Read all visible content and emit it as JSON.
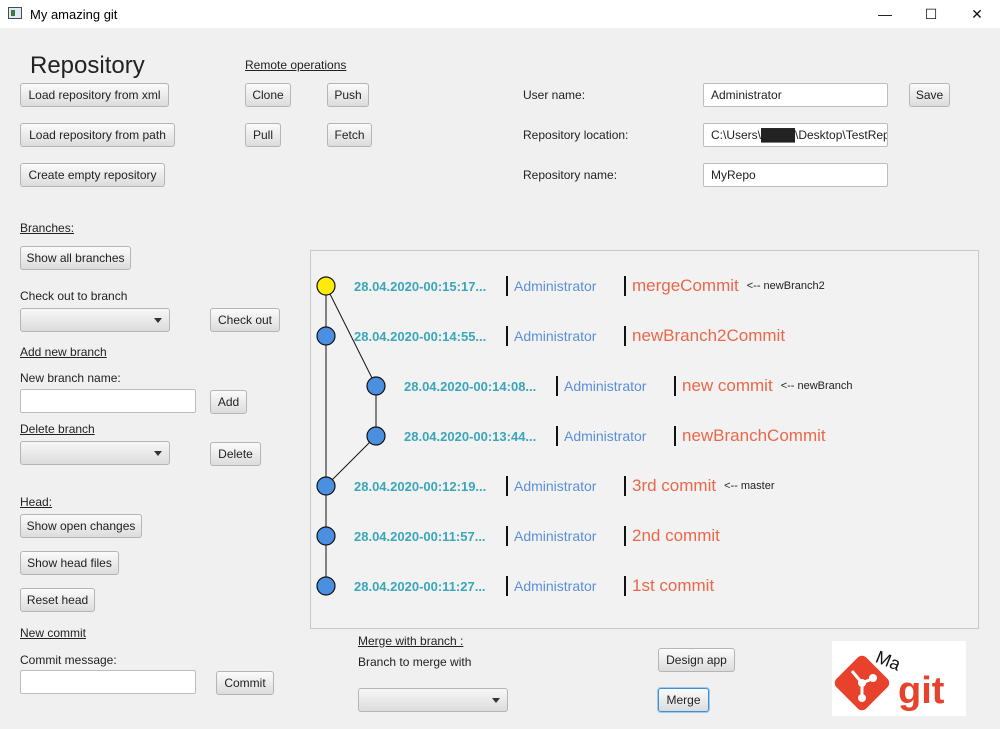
{
  "window": {
    "title": "My amazing git",
    "minimize": "—",
    "maximize": "☐",
    "close": "✕"
  },
  "heading": "Repository",
  "repo_buttons": {
    "load_xml": "Load repository from xml",
    "load_path": "Load repository from path",
    "create_empty": "Create empty repository"
  },
  "remote": {
    "title": "Remote operations",
    "clone": "Clone",
    "push": "Push",
    "pull": "Pull",
    "fetch": "Fetch"
  },
  "settings": {
    "user_name_label": "User name:",
    "user_name_value": "Administrator",
    "save": "Save",
    "location_label": "Repository location:",
    "location_value": "C:\\Users\\████\\Desktop\\TestRep",
    "name_label": "Repository name:",
    "name_value": "MyRepo"
  },
  "branches": {
    "title": "Branches:",
    "show_all": "Show all branches",
    "checkout_label": "Check out to branch",
    "checkout_button": "Check out",
    "add_title": "Add new branch",
    "new_name_label": "New branch name:",
    "add_button": "Add",
    "delete_title": "Delete branch",
    "delete_button": "Delete"
  },
  "head": {
    "title": "Head:",
    "show_open_changes": "Show open changes",
    "show_head_files": "Show head files",
    "reset_head": "Reset head"
  },
  "commit": {
    "title": "New commit",
    "message_label": "Commit message:",
    "commit_button": "Commit"
  },
  "merge": {
    "title": "Merge with branch :",
    "branch_label": "Branch to merge with",
    "design_app": "Design app",
    "merge_button": "Merge"
  },
  "commits": [
    {
      "date": "28.04.2020-00:15:17...",
      "author": "Administrator",
      "message": "mergeCommit",
      "branch": "<-- newBranch2",
      "lane": 0,
      "color": "#ffeb0a"
    },
    {
      "date": "28.04.2020-00:14:55...",
      "author": "Administrator",
      "message": "newBranch2Commit",
      "branch": "",
      "lane": 0,
      "color": "#4a8fe0"
    },
    {
      "date": "28.04.2020-00:14:08...",
      "author": "Administrator",
      "message": "new commit",
      "branch": "<-- newBranch",
      "lane": 1,
      "color": "#4a8fe0"
    },
    {
      "date": "28.04.2020-00:13:44...",
      "author": "Administrator",
      "message": "newBranchCommit",
      "branch": "",
      "lane": 1,
      "color": "#4a8fe0"
    },
    {
      "date": "28.04.2020-00:12:19...",
      "author": "Administrator",
      "message": "3rd commit",
      "branch": "<-- master",
      "lane": 0,
      "color": "#4a8fe0"
    },
    {
      "date": "28.04.2020-00:11:57...",
      "author": "Administrator",
      "message": "2nd commit",
      "branch": "",
      "lane": 0,
      "color": "#4a8fe0"
    },
    {
      "date": "28.04.2020-00:11:27...",
      "author": "Administrator",
      "message": "1st commit",
      "branch": "",
      "lane": 0,
      "color": "#4a8fe0"
    }
  ],
  "logo": {
    "small": "Ma",
    "big": "git",
    "color": "#e8412c"
  }
}
